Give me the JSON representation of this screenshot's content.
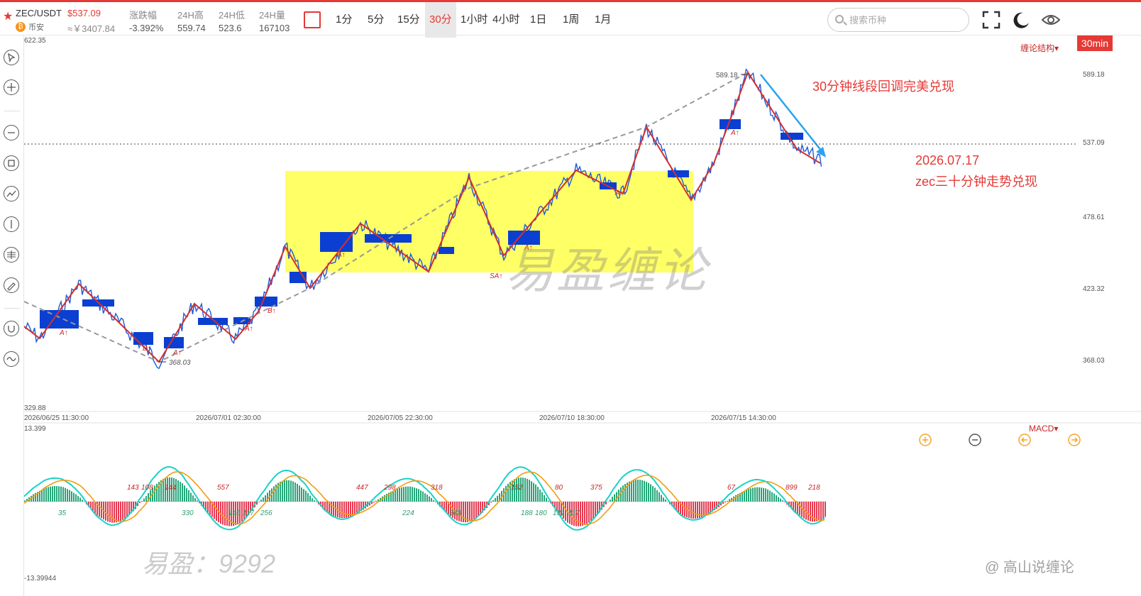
{
  "header": {
    "pair": "ZEC/USDT",
    "price": "$537.09",
    "exchange": "币安",
    "cny_price": "≈￥3407.84",
    "stats": [
      {
        "label": "涨跌幅",
        "value": "-3.392%"
      },
      {
        "label": "24H高",
        "value": "559.74"
      },
      {
        "label": "24H低",
        "value": "523.6"
      },
      {
        "label": "24H量",
        "value": "167103"
      }
    ],
    "periods": [
      "1分",
      "5分",
      "15分",
      "30分",
      "1小时",
      "4小时",
      "1日",
      "1周",
      "1月"
    ],
    "active_period": "30分",
    "search_placeholder": "搜索币种"
  },
  "toolbar_icons": [
    "cursor-icon",
    "crosshair-plus-icon",
    "line-tool-icon",
    "rectangle-tool-icon",
    "trend-tool-icon",
    "vertical-line-icon",
    "fib-tool-icon",
    "brush-tool-icon",
    "magnet-icon",
    "wave-tool-icon"
  ],
  "top_icons": [
    "fullscreen-icon",
    "night-mode-icon",
    "eye-icon"
  ],
  "chart": {
    "timeframe_badge": "30min",
    "indicator_menu": "缠论结构",
    "macd_menu": "MACD",
    "price_axis_labels": [
      "589.18",
      "537.09",
      "478.61",
      "423.32",
      "368.03"
    ],
    "current_price": "537.09",
    "top_left_value": "622.35",
    "bottom_left_value": "329.88",
    "time_labels": [
      "2026/06/25 11:30:00",
      "2026/07/01 02:30:00",
      "2026/07/05 22:30:00",
      "2026/07/10 18:30:00",
      "2026/07/15 14:30:00"
    ],
    "high_label": "589.18",
    "low_label": "368.03",
    "macd_top": "13.399",
    "macd_bottom": "-13.39944",
    "signal_labels": [
      "A↑",
      "B↑",
      "A↑",
      "A↑",
      "B↑",
      "A↑",
      "SA↑",
      "A↑",
      "A↑",
      "A↑"
    ],
    "macd_area_labels_top": [
      "143",
      "108",
      "144",
      "557",
      "447",
      "298",
      "318",
      "152",
      "80",
      "375",
      "67",
      "899",
      "218"
    ],
    "macd_area_labels_bottom": [
      "35",
      "330",
      "146",
      "117",
      "256",
      "224",
      "363",
      "188",
      "180",
      "131",
      "117"
    ]
  },
  "annotations": {
    "line1": "30分钟线段回调完美兑现",
    "line2": "2026.07.17",
    "line3": "zec三十分钟走势兑现"
  },
  "watermarks": {
    "main": "易盈缠论",
    "bottom": "易盈：9292",
    "bottom_right": "@ 高山说缠论"
  },
  "colors": {
    "accent": "#e53935",
    "candle": "#1e5bd8",
    "zhongshu_box": "#ffff66",
    "stroke": "#d32f2f",
    "segment": "#999999",
    "macd_fast": "#19d3c5",
    "macd_slow": "#f39c12",
    "bar_up": "#26a67a",
    "bar_down": "#e53950",
    "trend_arrow": "#29a3ef"
  }
}
